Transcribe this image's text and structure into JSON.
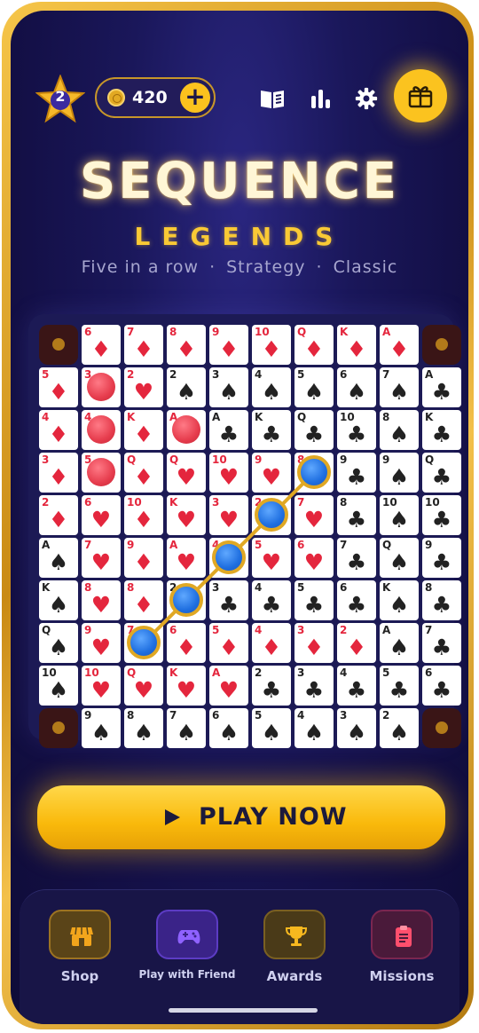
{
  "header": {
    "level": "2",
    "coins": "420",
    "add_coins": "+",
    "icons": [
      "rules-book-icon",
      "stats-icon",
      "settings-gear-icon",
      "gift-icon"
    ]
  },
  "title": {
    "main": "SEQUENCE",
    "sub": "LEGENDS",
    "tagline": [
      "Five in a row",
      "Strategy",
      "Classic"
    ],
    "tagline_sep": "·"
  },
  "board": {
    "rows": [
      [
        "",
        "6♦",
        "7♦",
        "8♦",
        "9♦",
        "10♦",
        "Q♦",
        "K♦",
        "A♦",
        ""
      ],
      [
        "5♦",
        "3♥",
        "2♥",
        "2♠",
        "3♠",
        "4♠",
        "5♠",
        "6♠",
        "7♠",
        "A♣"
      ],
      [
        "4♦",
        "4♥",
        "K♦",
        "A♦",
        "A♣",
        "K♣",
        "Q♣",
        "10♣",
        "8♠",
        "K♣"
      ],
      [
        "3♦",
        "5♥",
        "Q♦",
        "Q♥",
        "10♥",
        "9♥",
        "8♥",
        "9♣",
        "9♠",
        "Q♣"
      ],
      [
        "2♦",
        "6♥",
        "10♦",
        "K♥",
        "3♥",
        "2♥",
        "7♥",
        "8♣",
        "10♠",
        "10♣"
      ],
      [
        "A♠",
        "7♥",
        "9♦",
        "A♥",
        "4♥",
        "5♥",
        "6♥",
        "7♣",
        "Q♠",
        "9♣"
      ],
      [
        "K♠",
        "8♥",
        "8♦",
        "2♣",
        "3♣",
        "4♣",
        "5♣",
        "6♣",
        "K♠",
        "8♣"
      ],
      [
        "Q♠",
        "9♥",
        "7♦",
        "6♦",
        "5♦",
        "4♦",
        "3♦",
        "2♦",
        "A♠",
        "7♣"
      ],
      [
        "10♠",
        "10♥",
        "Q♥",
        "K♥",
        "A♥",
        "2♣",
        "3♣",
        "4♣",
        "5♣",
        "6♣"
      ],
      [
        "",
        "9♠",
        "8♠",
        "7♠",
        "6♠",
        "5♠",
        "4♠",
        "3♠",
        "2♠",
        ""
      ]
    ],
    "red_chips": [
      [
        1,
        1
      ],
      [
        2,
        1
      ],
      [
        3,
        1
      ],
      [
        2,
        3
      ]
    ],
    "blue_chips": [
      [
        7,
        2
      ],
      [
        6,
        3
      ],
      [
        5,
        4
      ],
      [
        4,
        5
      ],
      [
        3,
        6
      ]
    ],
    "colors": {
      "red_suit": "#e4263d",
      "black_suit": "#222222",
      "red_chip": "#e63c4d",
      "blue_chip": "#1f6fe0",
      "chip_ring": "#e0a824"
    }
  },
  "play_button": {
    "label": "PLAY NOW"
  },
  "nav": [
    {
      "label": "Shop",
      "icon": "shop-icon",
      "color": "#f2a51c"
    },
    {
      "label": "Play with Friend",
      "icon": "gamepad-icon",
      "color": "#7c4dff"
    },
    {
      "label": "Awards",
      "icon": "trophy-icon",
      "color": "#f2a51c"
    },
    {
      "label": "Missions",
      "icon": "clipboard-icon",
      "color": "#ff4f6d"
    }
  ]
}
